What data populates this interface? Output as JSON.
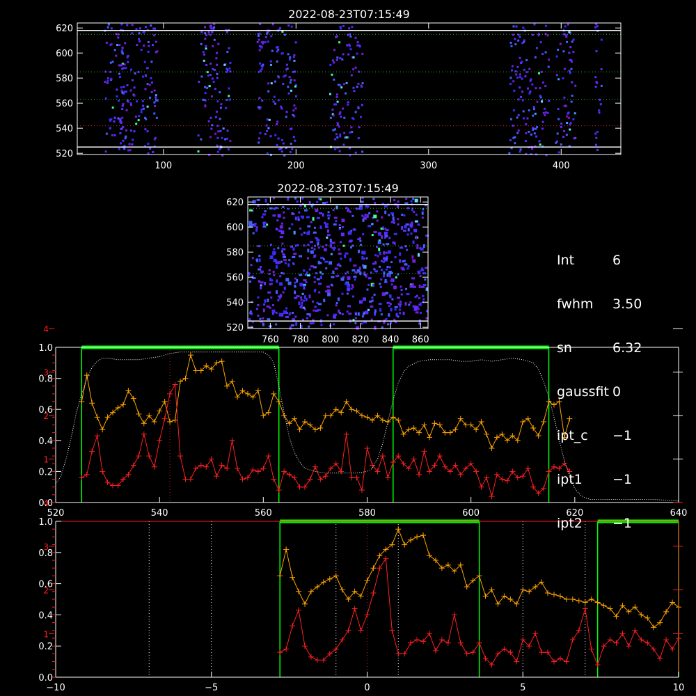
{
  "colors": {
    "background": "#000000",
    "axis": "#ffffff",
    "green_band": "#00ff00",
    "orange": "#ffa500",
    "red": "#ff2020",
    "dotted_green": "#30c030",
    "dotted_red": "#d02020",
    "spectrum_dotted": "#ffffff"
  },
  "info": {
    "items": [
      {
        "key": "Int",
        "value": "6"
      },
      {
        "key": "fwhm",
        "value": "3.50"
      },
      {
        "key": "sn",
        "value": "6.32"
      },
      {
        "key": "gaussfit",
        "value": "0"
      },
      {
        "key": "ipt_c",
        "value": "−1"
      },
      {
        "key": "ipt1",
        "value": "−1"
      },
      {
        "key": "ipt2",
        "value": "−1"
      }
    ]
  },
  "chart_data": [
    {
      "type": "heatmap",
      "title": "2022-08-23T07:15:49",
      "xlim": [
        35,
        445
      ],
      "ylim": [
        519,
        624
      ],
      "xticks": [
        100,
        200,
        300,
        400
      ],
      "yticks": [
        520,
        540,
        560,
        580,
        600,
        620
      ],
      "hlines_white": [
        525,
        618
      ],
      "hlines_green": [
        563,
        585,
        615
      ],
      "hlines_red": [
        542
      ],
      "bright_columns": [
        [
          55,
          70
        ],
        [
          65,
          95
        ],
        [
          125,
          150
        ],
        [
          170,
          200
        ],
        [
          225,
          250
        ],
        [
          360,
          390
        ],
        [
          395,
          410
        ],
        [
          425,
          430
        ]
      ]
    },
    {
      "type": "heatmap",
      "title": "2022-08-23T07:15:49",
      "xlim": [
        745,
        865
      ],
      "ylim": [
        519,
        624
      ],
      "xticks": [
        760,
        780,
        800,
        820,
        840,
        860
      ],
      "yticks": [
        520,
        540,
        560,
        580,
        600,
        620
      ],
      "hlines_white": [
        525,
        618
      ],
      "hlines_green": [
        563,
        585,
        615
      ]
    },
    {
      "type": "line",
      "xlim": [
        520,
        640
      ],
      "ylim": [
        0,
        1
      ],
      "xticks": [
        520,
        540,
        560,
        580,
        600,
        620,
        640
      ],
      "yticks_left": [
        "0.0",
        "0.2",
        "0.4",
        "0.6",
        "0.8",
        "1.0"
      ],
      "yticks_red": [
        "1",
        "2",
        "3",
        "4"
      ],
      "green_bands": [
        [
          525,
          563
        ],
        [
          585,
          615
        ]
      ],
      "red_vline": 542,
      "series": [
        {
          "name": "",
          "color": "orange",
          "x": [
            525,
            526,
            527,
            528,
            529,
            530,
            531,
            532,
            533,
            534,
            535,
            536,
            537,
            538,
            539,
            540,
            541,
            542,
            543,
            544,
            545,
            546,
            547,
            548,
            549,
            550,
            551,
            552,
            553,
            554,
            555,
            556,
            557,
            558,
            559,
            560,
            561,
            562,
            563,
            564,
            565,
            566,
            567,
            568,
            569,
            570,
            571,
            572,
            573,
            574,
            575,
            576,
            577,
            578,
            579,
            580,
            581,
            582,
            583,
            584,
            585,
            586,
            587,
            588,
            589,
            590,
            591,
            592,
            593,
            594,
            595,
            596,
            597,
            598,
            599,
            600,
            601,
            602,
            603,
            604,
            605,
            606,
            607,
            608,
            609,
            610,
            611,
            612,
            613,
            614,
            615,
            616,
            617,
            618,
            619
          ],
          "y": [
            0.65,
            0.82,
            0.64,
            0.55,
            0.47,
            0.55,
            0.58,
            0.61,
            0.63,
            0.72,
            0.67,
            0.57,
            0.51,
            0.56,
            0.52,
            0.59,
            0.65,
            0.52,
            0.53,
            0.78,
            0.8,
            0.95,
            0.85,
            0.85,
            0.88,
            0.86,
            0.9,
            0.91,
            0.75,
            0.78,
            0.68,
            0.72,
            0.7,
            0.68,
            0.72,
            0.56,
            0.58,
            0.7,
            0.65,
            0.56,
            0.51,
            0.54,
            0.47,
            0.52,
            0.5,
            0.47,
            0.48,
            0.56,
            0.56,
            0.6,
            0.58,
            0.65,
            0.6,
            0.59,
            0.56,
            0.55,
            0.53,
            0.56,
            0.53,
            0.52,
            0.55,
            0.53,
            0.44,
            0.47,
            0.48,
            0.45,
            0.5,
            0.42,
            0.51,
            0.5,
            0.45,
            0.45,
            0.47,
            0.54,
            0.5,
            0.5,
            0.47,
            0.52,
            0.44,
            0.35,
            0.42,
            0.44,
            0.4,
            0.43,
            0.4,
            0.52,
            0.54,
            0.48,
            0.43,
            0.52,
            0.65,
            0.63,
            0.65,
            0.42,
            0.54
          ]
        },
        {
          "name": "",
          "color": "red",
          "x": [
            525,
            526,
            527,
            528,
            529,
            530,
            531,
            532,
            533,
            534,
            535,
            536,
            537,
            538,
            539,
            540,
            541,
            542,
            543,
            544,
            545,
            546,
            547,
            548,
            549,
            550,
            551,
            552,
            553,
            554,
            555,
            556,
            557,
            558,
            559,
            560,
            561,
            562,
            563,
            564,
            565,
            566,
            567,
            568,
            569,
            570,
            571,
            572,
            573,
            574,
            575,
            576,
            577,
            578,
            579,
            580,
            581,
            582,
            583,
            584,
            585,
            586,
            587,
            588,
            589,
            590,
            591,
            592,
            593,
            594,
            595,
            596,
            597,
            598,
            599,
            600,
            601,
            602,
            603,
            604,
            605,
            606,
            607,
            608,
            609,
            610,
            611,
            612,
            613,
            614,
            615,
            616,
            617,
            618,
            619
          ],
          "y": [
            0.16,
            0.18,
            0.33,
            0.43,
            0.2,
            0.13,
            0.11,
            0.11,
            0.15,
            0.18,
            0.24,
            0.3,
            0.44,
            0.3,
            0.23,
            0.4,
            0.54,
            0.7,
            0.76,
            0.3,
            0.15,
            0.15,
            0.22,
            0.24,
            0.23,
            0.28,
            0.17,
            0.24,
            0.22,
            0.4,
            0.22,
            0.15,
            0.16,
            0.21,
            0.2,
            0.22,
            0.3,
            0.15,
            0.08,
            0.2,
            0.18,
            0.16,
            0.1,
            0.1,
            0.15,
            0.23,
            0.15,
            0.17,
            0.22,
            0.25,
            0.2,
            0.44,
            0.16,
            0.16,
            0.08,
            0.35,
            0.24,
            0.2,
            0.3,
            0.16,
            0.26,
            0.3,
            0.25,
            0.22,
            0.28,
            0.18,
            0.33,
            0.2,
            0.24,
            0.3,
            0.23,
            0.2,
            0.24,
            0.18,
            0.22,
            0.25,
            0.2,
            0.1,
            0.16,
            0.04,
            0.18,
            0.15,
            0.14,
            0.2,
            0.16,
            0.17,
            0.22,
            0.1,
            0.06,
            0.09,
            0.2,
            0.23,
            0.22,
            0.25,
            0.2
          ]
        },
        {
          "name": "",
          "color": "spectrum_dotted",
          "x": [
            520,
            521,
            522,
            523,
            524,
            525,
            526,
            527,
            528,
            529,
            530,
            532,
            534,
            536,
            538,
            540,
            542,
            544,
            546,
            548,
            550,
            552,
            554,
            556,
            558,
            560,
            561,
            562,
            563,
            564,
            565,
            566,
            567,
            568,
            570,
            572,
            574,
            576,
            578,
            580,
            581,
            582,
            583,
            584,
            585,
            586,
            587,
            588,
            590,
            592,
            594,
            596,
            598,
            600,
            602,
            604,
            606,
            608,
            610,
            612,
            613,
            614,
            615,
            616,
            617,
            618,
            619,
            620,
            621,
            622,
            623,
            624,
            625,
            630,
            635,
            640
          ],
          "y": [
            0.12,
            0.17,
            0.28,
            0.42,
            0.58,
            0.7,
            0.8,
            0.87,
            0.91,
            0.93,
            0.93,
            0.92,
            0.92,
            0.92,
            0.93,
            0.94,
            0.96,
            0.97,
            0.97,
            0.97,
            0.97,
            0.97,
            0.97,
            0.97,
            0.97,
            0.97,
            0.95,
            0.9,
            0.75,
            0.58,
            0.42,
            0.32,
            0.26,
            0.22,
            0.2,
            0.19,
            0.19,
            0.19,
            0.19,
            0.2,
            0.22,
            0.28,
            0.38,
            0.52,
            0.66,
            0.77,
            0.84,
            0.88,
            0.91,
            0.92,
            0.92,
            0.92,
            0.91,
            0.91,
            0.92,
            0.91,
            0.92,
            0.93,
            0.92,
            0.9,
            0.86,
            0.78,
            0.68,
            0.55,
            0.4,
            0.27,
            0.17,
            0.09,
            0.05,
            0.03,
            0.02,
            0.02,
            0.02,
            0.02,
            0.02,
            0.01
          ]
        }
      ]
    },
    {
      "type": "line",
      "xlim": [
        -10,
        10
      ],
      "ylim": [
        0,
        1
      ],
      "xticks": [
        -10,
        -5,
        0,
        5,
        10
      ],
      "yticks_left": [
        "0.0",
        "0.2",
        "0.4",
        "0.6",
        "0.8",
        "1.0"
      ],
      "yticks_red": [
        "1",
        "2",
        "3",
        "4"
      ],
      "green_bands": [
        [
          -2.8,
          3.6
        ],
        [
          7.4,
          10
        ]
      ],
      "white_vlines": [
        -7,
        -5,
        -1,
        1,
        5,
        7
      ],
      "red_vline": 0,
      "series": [
        {
          "name": "",
          "color": "orange",
          "x": [
            -2.8,
            -2.6,
            -2.4,
            -2.2,
            -2.0,
            -1.8,
            -1.6,
            -1.4,
            -1.2,
            -1.0,
            -0.8,
            -0.6,
            -0.4,
            -0.2,
            0.0,
            0.2,
            0.4,
            0.6,
            0.8,
            1.0,
            1.2,
            1.4,
            1.6,
            1.8,
            2.0,
            2.2,
            2.4,
            2.6,
            2.8,
            3.0,
            3.2,
            3.4,
            3.6,
            3.8,
            4.0,
            4.2,
            4.4,
            4.6,
            4.8,
            5.0,
            5.2,
            5.4,
            5.6,
            5.8,
            6.0,
            6.2,
            6.4,
            6.6,
            6.8,
            7.0,
            7.2,
            7.4,
            7.6,
            7.8,
            8.0,
            8.2,
            8.4,
            8.6,
            8.8,
            9.0,
            9.2,
            9.4,
            9.6,
            9.8,
            10.0
          ],
          "y": [
            0.65,
            0.82,
            0.64,
            0.55,
            0.47,
            0.55,
            0.58,
            0.61,
            0.63,
            0.65,
            0.56,
            0.5,
            0.55,
            0.52,
            0.62,
            0.7,
            0.78,
            0.82,
            0.85,
            0.95,
            0.85,
            0.88,
            0.9,
            0.91,
            0.78,
            0.75,
            0.7,
            0.72,
            0.68,
            0.72,
            0.58,
            0.62,
            0.65,
            0.52,
            0.56,
            0.47,
            0.52,
            0.5,
            0.47,
            0.56,
            0.55,
            0.58,
            0.61,
            0.54,
            0.53,
            0.52,
            0.5,
            0.5,
            0.49,
            0.48,
            0.5,
            0.48,
            0.46,
            0.44,
            0.39,
            0.46,
            0.42,
            0.45,
            0.4,
            0.38,
            0.32,
            0.35,
            0.42,
            0.48,
            0.45
          ]
        },
        {
          "name": "",
          "color": "red",
          "x": [
            -2.8,
            -2.6,
            -2.4,
            -2.2,
            -2.0,
            -1.8,
            -1.6,
            -1.4,
            -1.2,
            -1.0,
            -0.8,
            -0.6,
            -0.4,
            -0.2,
            0.0,
            0.2,
            0.4,
            0.6,
            0.8,
            1.0,
            1.2,
            1.4,
            1.6,
            1.8,
            2.0,
            2.2,
            2.4,
            2.6,
            2.8,
            3.0,
            3.2,
            3.4,
            3.6,
            3.8,
            4.0,
            4.2,
            4.4,
            4.6,
            4.8,
            5.0,
            5.2,
            5.4,
            5.6,
            5.8,
            6.0,
            6.2,
            6.4,
            6.6,
            6.8,
            7.0,
            7.2,
            7.4,
            7.6,
            7.8,
            8.0,
            8.2,
            8.4,
            8.6,
            8.8,
            9.0,
            9.2,
            9.4,
            9.6,
            9.8,
            10.0
          ],
          "y": [
            0.16,
            0.18,
            0.33,
            0.43,
            0.2,
            0.13,
            0.11,
            0.11,
            0.15,
            0.18,
            0.24,
            0.3,
            0.44,
            0.3,
            0.4,
            0.54,
            0.7,
            0.76,
            0.3,
            0.15,
            0.15,
            0.22,
            0.24,
            0.23,
            0.28,
            0.17,
            0.24,
            0.22,
            0.4,
            0.22,
            0.15,
            0.16,
            0.22,
            0.12,
            0.08,
            0.15,
            0.18,
            0.16,
            0.1,
            0.24,
            0.2,
            0.28,
            0.16,
            0.16,
            0.1,
            0.12,
            0.1,
            0.24,
            0.3,
            0.44,
            0.18,
            0.08,
            0.2,
            0.24,
            0.22,
            0.28,
            0.2,
            0.3,
            0.24,
            0.22,
            0.18,
            0.12,
            0.24,
            0.18,
            0.25
          ]
        }
      ]
    }
  ]
}
